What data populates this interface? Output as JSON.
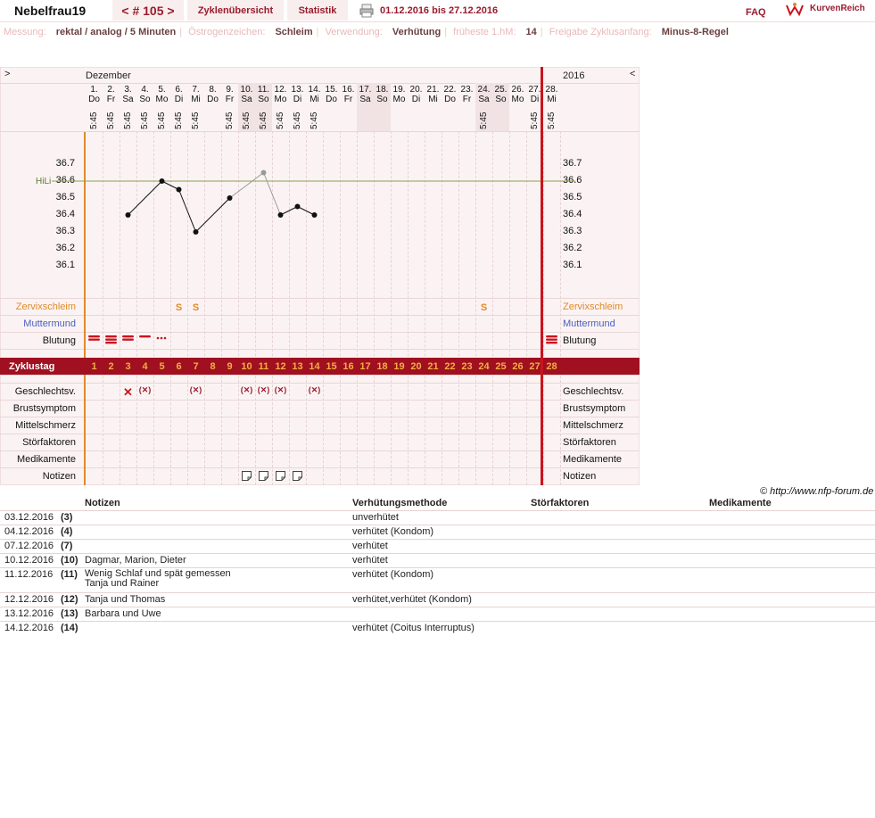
{
  "header": {
    "user": "Nebelfrau19",
    "cycle": "< # 105 >",
    "overview": "Zyklenübersicht",
    "statistics": "Statistik",
    "date_range": "01.12.2016 bis 27.12.2016",
    "faq": "FAQ",
    "logo_text": "KurvenReich"
  },
  "info": {
    "messung_label": "Messung:",
    "messung_value": "rektal / analog / 5 Minuten",
    "oestrogen_label": "Östrogenzeichen:",
    "oestrogen_value": "Schleim",
    "verwendung_label": "Verwendung:",
    "verwendung_value": "Verhütung",
    "hm_label": "früheste 1.hM:",
    "hm_value": "14",
    "freigabe_label": "Freigabe Zyklusanfang:",
    "freigabe_value": "Minus-8-Regel"
  },
  "chart": {
    "nav_left": ">",
    "nav_right": "<",
    "month": "Dezember",
    "year": "2016",
    "hili_label": "HiLi",
    "row_labels": {
      "zervix": "Zervixschleim",
      "muttermund": "Muttermund",
      "blutung": "Blutung",
      "zyklustag": "Zyklustag",
      "gv": "Geschlechtsv.",
      "brust": "Brustsymptom",
      "mittel": "Mittelschmerz",
      "stoer": "Störfaktoren",
      "medi": "Medikamente",
      "notizen": "Notizen"
    },
    "y_ticks": [
      "36.7",
      "36.6",
      "36.5",
      "36.4",
      "36.3",
      "36.2",
      "36.1"
    ],
    "days": [
      {
        "date": "1.",
        "wd": "Do",
        "time": "5:45"
      },
      {
        "date": "2.",
        "wd": "Fr",
        "time": "5:45"
      },
      {
        "date": "3.",
        "wd": "Sa",
        "time": "5:45"
      },
      {
        "date": "4.",
        "wd": "So",
        "time": "5:45"
      },
      {
        "date": "5.",
        "wd": "Mo",
        "time": "5:45"
      },
      {
        "date": "6.",
        "wd": "Di",
        "time": "5:45"
      },
      {
        "date": "7.",
        "wd": "Mi",
        "time": "5:45"
      },
      {
        "date": "8.",
        "wd": "Do",
        "time": ""
      },
      {
        "date": "9.",
        "wd": "Fr",
        "time": "5:45"
      },
      {
        "date": "10.",
        "wd": "Sa",
        "time": "5:45"
      },
      {
        "date": "11.",
        "wd": "So",
        "time": "5:45"
      },
      {
        "date": "12.",
        "wd": "Mo",
        "time": "5:45"
      },
      {
        "date": "13.",
        "wd": "Di",
        "time": "5:45"
      },
      {
        "date": "14.",
        "wd": "Mi",
        "time": "5:45"
      },
      {
        "date": "15.",
        "wd": "Do",
        "time": ""
      },
      {
        "date": "16.",
        "wd": "Fr",
        "time": ""
      },
      {
        "date": "17.",
        "wd": "Sa",
        "time": ""
      },
      {
        "date": "18.",
        "wd": "So",
        "time": ""
      },
      {
        "date": "19.",
        "wd": "Mo",
        "time": ""
      },
      {
        "date": "20.",
        "wd": "Di",
        "time": ""
      },
      {
        "date": "21.",
        "wd": "Mi",
        "time": ""
      },
      {
        "date": "22.",
        "wd": "Do",
        "time": ""
      },
      {
        "date": "23.",
        "wd": "Fr",
        "time": ""
      },
      {
        "date": "24.",
        "wd": "Sa",
        "time": "5:45"
      },
      {
        "date": "25.",
        "wd": "So",
        "time": ""
      },
      {
        "date": "26.",
        "wd": "Mo",
        "time": ""
      },
      {
        "date": "27.",
        "wd": "Di",
        "time": "5:45"
      },
      {
        "date": "28.",
        "wd": "Mi",
        "time": "5:45"
      }
    ],
    "cycle_days": [
      "1",
      "2",
      "3",
      "4",
      "5",
      "6",
      "7",
      "8",
      "9",
      "10",
      "11",
      "12",
      "13",
      "14",
      "15",
      "16",
      "17",
      "18",
      "19",
      "20",
      "21",
      "22",
      "23",
      "24",
      "25",
      "26",
      "27",
      "28"
    ],
    "zervix_marks": [
      {
        "day": 6,
        "text": "S"
      },
      {
        "day": 7,
        "text": "S"
      },
      {
        "day": 24,
        "text": "S"
      }
    ],
    "gv_marks": [
      {
        "day": 3,
        "text": "✕"
      },
      {
        "day": 4,
        "text": "(✕)"
      },
      {
        "day": 7,
        "text": "(✕)"
      },
      {
        "day": 10,
        "text": "(✕)"
      },
      {
        "day": 11,
        "text": "(✕)"
      },
      {
        "day": 12,
        "text": "(✕)"
      },
      {
        "day": 14,
        "text": "(✕)"
      }
    ],
    "credit": "© http://www.nfp-forum.de"
  },
  "chart_data": {
    "type": "line",
    "hili": 36.6,
    "ylim": [
      36.0,
      36.8
    ],
    "series": [
      {
        "points": [
          [
            3,
            36.4
          ],
          [
            5,
            36.6
          ],
          [
            6,
            36.55
          ],
          [
            7,
            36.3
          ],
          [
            9,
            36.5
          ],
          [
            11,
            36.65
          ],
          [
            12,
            36.4
          ],
          [
            13,
            36.45
          ],
          [
            14,
            36.4
          ]
        ]
      }
    ]
  },
  "notes": {
    "headers": {
      "notizen": "Notizen",
      "methode": "Verhütungsmethode",
      "stoer": "Störfaktoren",
      "medi": "Medikamente"
    },
    "rows": [
      {
        "date": "03.12.2016",
        "day": "(3)",
        "note": "",
        "method": "unverhütet"
      },
      {
        "date": "04.12.2016",
        "day": "(4)",
        "note": "",
        "method": "verhütet (Kondom)"
      },
      {
        "date": "07.12.2016",
        "day": "(7)",
        "note": "",
        "method": "verhütet"
      },
      {
        "date": "10.12.2016",
        "day": "(10)",
        "note": "Dagmar, Marion, Dieter",
        "method": "verhütet"
      },
      {
        "date": "11.12.2016",
        "day": "(11)",
        "note": "Wenig Schlaf und spät gemessen",
        "note2": "Tanja und Rainer",
        "method": "verhütet (Kondom)"
      },
      {
        "date": "12.12.2016",
        "day": "(12)",
        "note": "Tanja und Thomas",
        "method": "verhütet,verhütet (Kondom)"
      },
      {
        "date": "13.12.2016",
        "day": "(13)",
        "note": "Barbara und Uwe",
        "method": ""
      },
      {
        "date": "14.12.2016",
        "day": "(14)",
        "note": "",
        "method": "verhütet (Coitus Interruptus)"
      }
    ]
  }
}
